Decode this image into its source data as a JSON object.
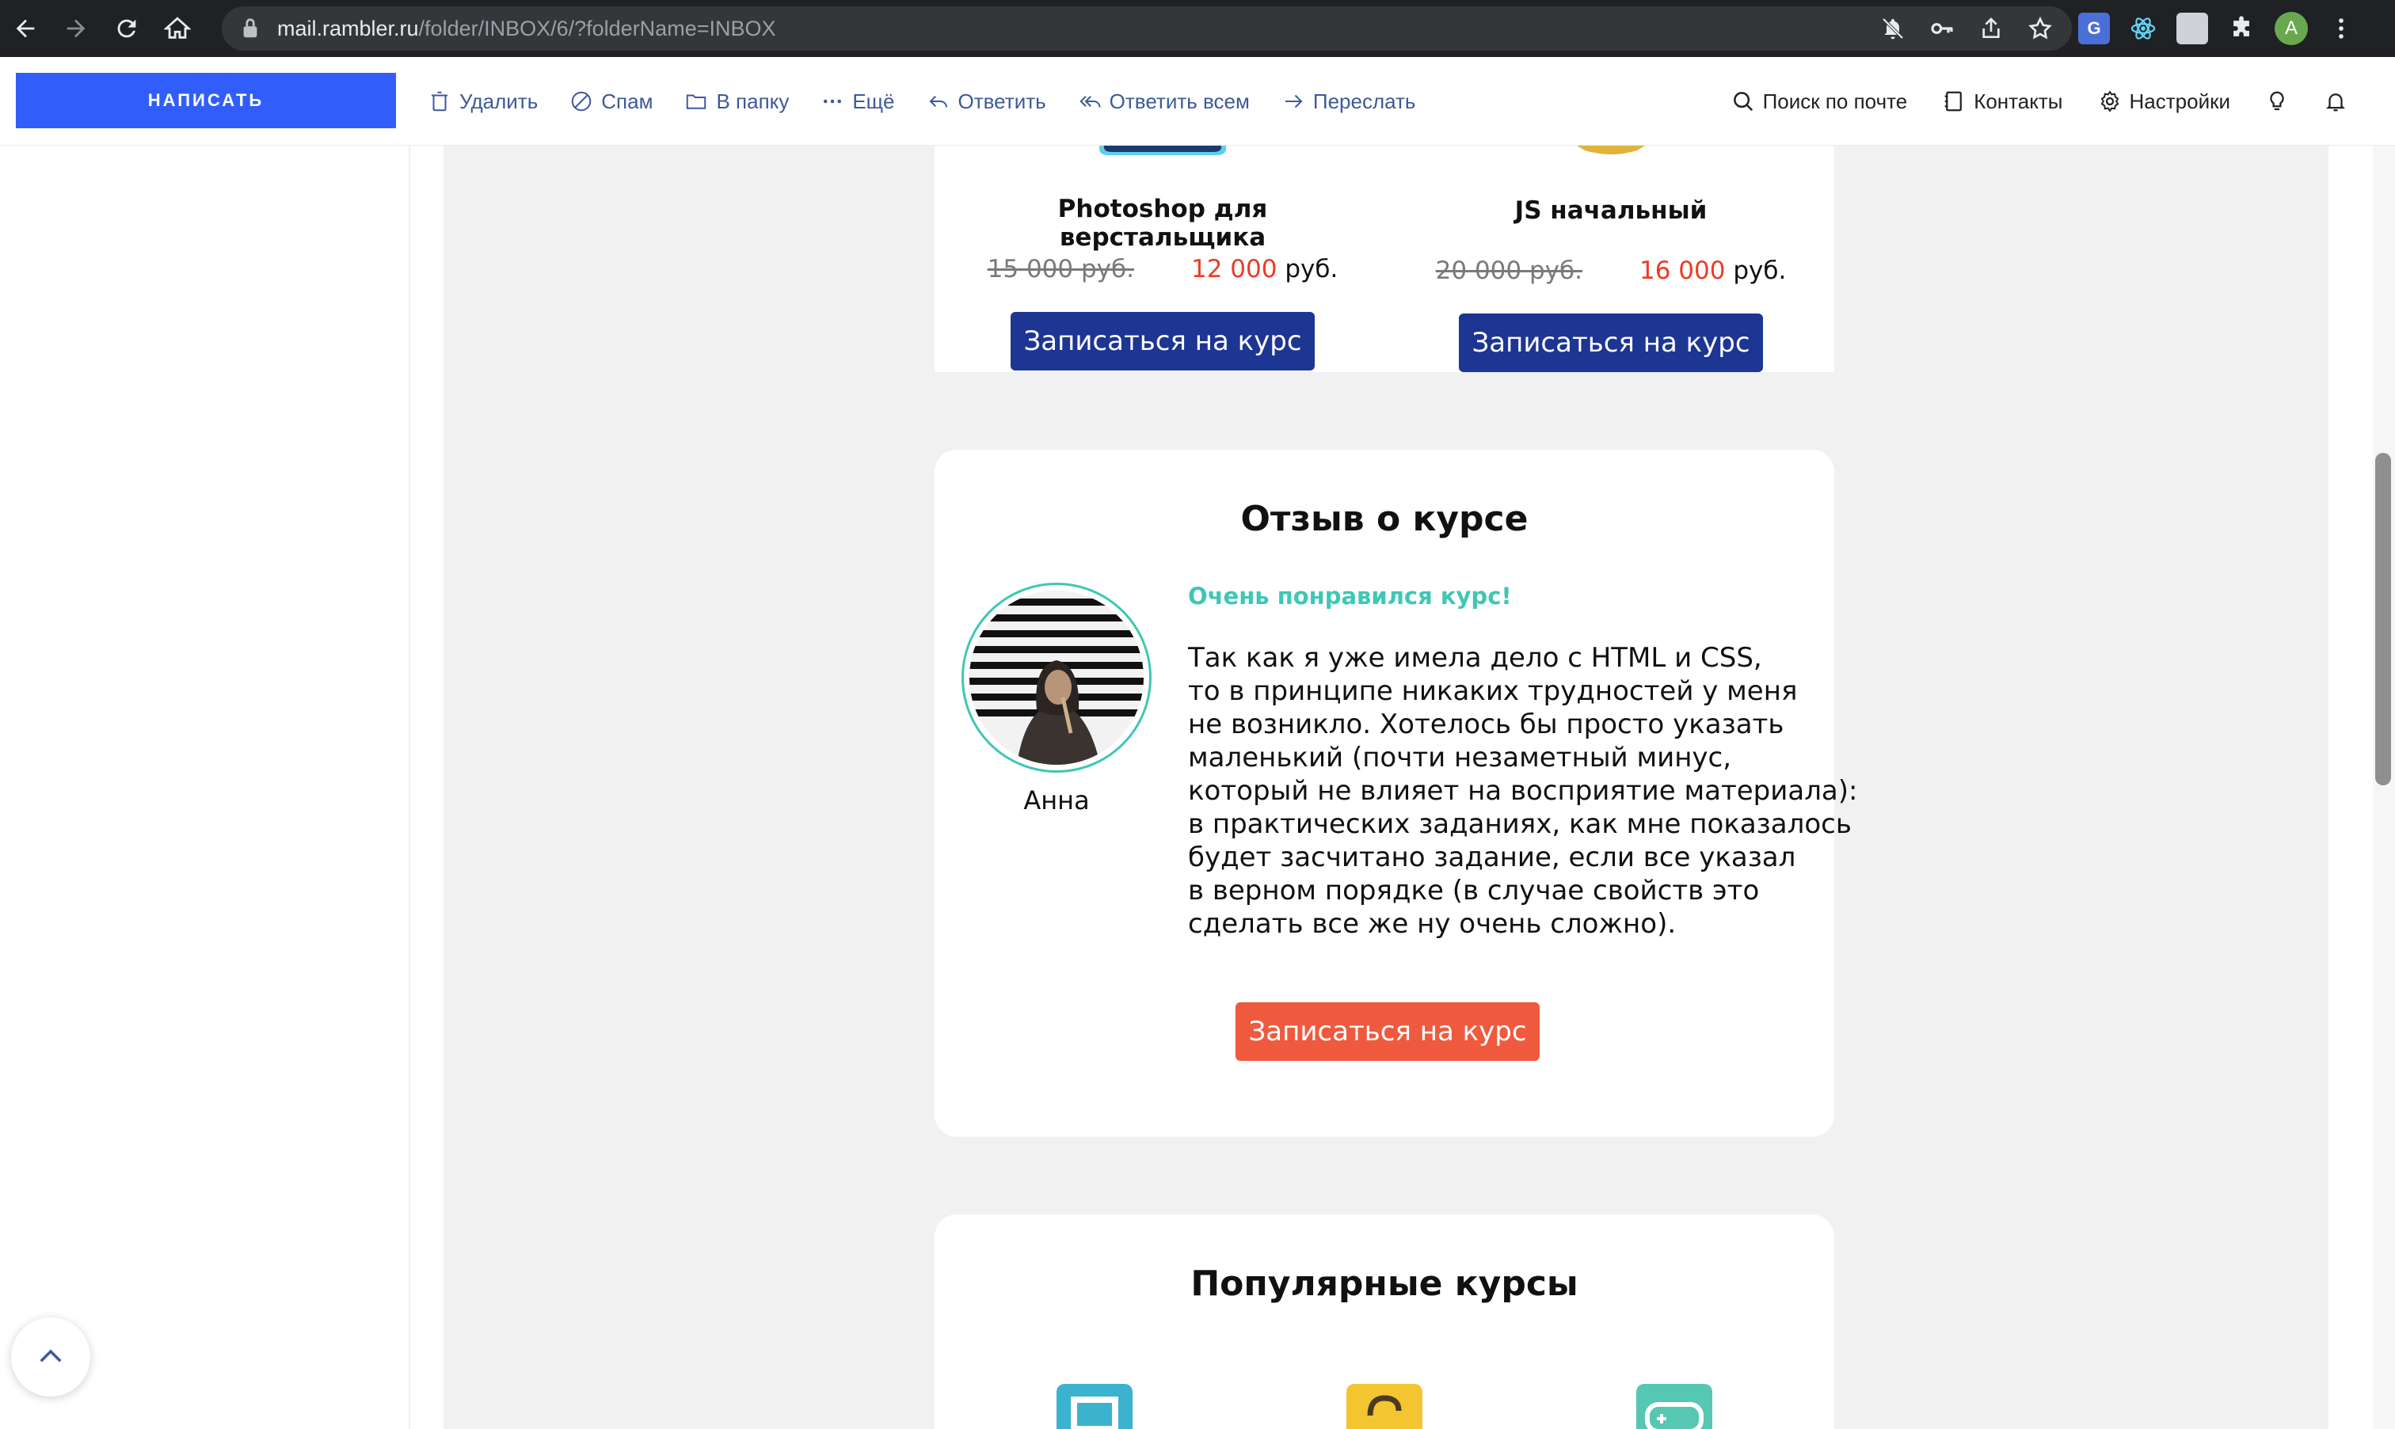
{
  "browser": {
    "url_host": "mail.rambler.ru",
    "url_path": "/folder/INBOX/6/?folderName=INBOX",
    "profile_initial": "A"
  },
  "toolbar": {
    "compose_label": "НАПИСАТЬ",
    "actions": [
      {
        "label": "Удалить",
        "icon": "trash-icon"
      },
      {
        "label": "Спам",
        "icon": "spam-icon"
      },
      {
        "label": "В папку",
        "icon": "folder-icon"
      },
      {
        "label": "Ещё",
        "icon": "more-icon"
      },
      {
        "label": "Ответить",
        "icon": "reply-icon"
      },
      {
        "label": "Ответить всем",
        "icon": "reply-all-icon"
      },
      {
        "label": "Переслать",
        "icon": "forward-icon"
      }
    ],
    "right": [
      {
        "label": "Поиск по почте",
        "icon": "search-icon"
      },
      {
        "label": "Контакты",
        "icon": "contacts-icon"
      },
      {
        "label": "Настройки",
        "icon": "gear-icon"
      }
    ]
  },
  "courses": [
    {
      "name": "Photoshop для верстальщика",
      "old_price": "15 000 руб.",
      "new_price": "12 000",
      "currency": "руб.",
      "button": "Записаться на курс"
    },
    {
      "name": "JS начальный",
      "old_price": "20 000 руб.",
      "new_price": "16 000",
      "currency": "руб.",
      "button": "Записаться на курс"
    }
  ],
  "review": {
    "title": "Отзыв о курсе",
    "reviewer": "Анна",
    "headline": "Очень понравился курс!",
    "lines": [
      "Так как я уже имела дело с HTML и CSS,",
      "то в принципе никаких трудностей у меня",
      "не возникло. Хотелось бы просто указать",
      "маленький (почти незаметный минус,",
      "который не влияет на восприятие материала):",
      "в практических заданиях, как мне показалось",
      "будет засчитано задание, если все указал",
      "в верном порядке (в случае свойств это",
      "сделать все же ну очень сложно)."
    ],
    "button": "Записаться на курс"
  },
  "popular": {
    "title": "Популярные курсы"
  },
  "colors": {
    "compose_blue": "#315efb",
    "course_button": "#1d3593",
    "cta_orange": "#ef5a3e",
    "accent_teal": "#3ec7b5",
    "price_red": "#ee3a24"
  }
}
